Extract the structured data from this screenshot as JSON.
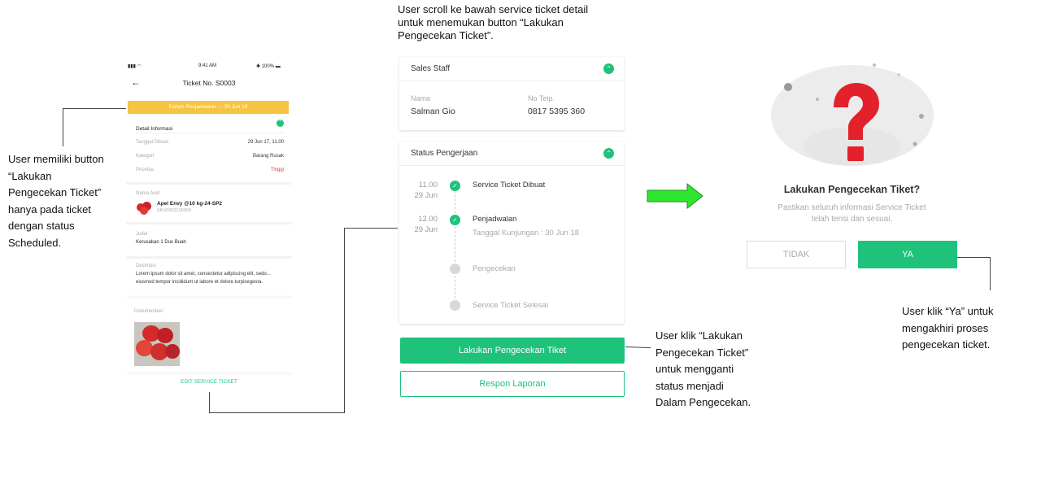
{
  "notes": {
    "top": "User scroll ke bawah  service ticket detail untuk menemukan  button “Lakukan Pengecekan Ticket”.",
    "left": "User memiliki button “Lakukan Pengecekan Ticket” hanya pada ticket dengan status Scheduled.",
    "middle": "User klik “Lakukan Pengecekan Ticket” untuk mengganti status menjadi Dalam Pengecekan.",
    "right": "User klik “Ya” untuk mengakhiri proses pengecekan ticket."
  },
  "phone1": {
    "status_time": "9:41 AM",
    "status_battery": "100%",
    "title": "Ticket No. S0003",
    "banner": "Dalam Penjadwalan — 30 Jun 18",
    "detail_header": "Detail Informasi",
    "rows": [
      {
        "label": "Tanggal Dibuat",
        "value": "29 Jun 17, 11.00"
      },
      {
        "label": "Kategori",
        "value": "Barang Rusak"
      },
      {
        "label": "Prioritas",
        "value": "Tinggi"
      }
    ],
    "asset_label": "Nama Aset",
    "asset_name": "Apel Envy @10 kg-24-SP2",
    "asset_sku": "SKU0002120004",
    "judul_label": "Judul",
    "judul_value": "Kerusakan 1 Dus Buah",
    "desc_label": "Deskripsi",
    "desc_value": "Lorem ipsum dolor sit amet, consectetur adipiscing elit, sedo... eiusmod tempor incididunt ut labore et dolore turpisegesta.",
    "doc_label": "Dokumentasi",
    "edit_button": "EDIT SERVICE TICKET"
  },
  "middle": {
    "sales_header": "Sales Staff",
    "nama_label": "Nama",
    "nama_value": "Salman Gio",
    "telp_label": "No Telp.",
    "telp_value": "0817 5395 360",
    "status_header": "Status Pengerjaan",
    "timeline": [
      {
        "time": "11.00",
        "date": "29 Jun",
        "label": "Service Ticket Dibuat",
        "done": true
      },
      {
        "time": "12.00",
        "date": "29 Jun",
        "label": "Penjadwalan",
        "sub": "Tanggal Kunjungan : 30 Jun 18",
        "done": true
      },
      {
        "label": "Pengecekan",
        "done": false
      },
      {
        "label": "Service Ticket Selesai",
        "done": false
      }
    ],
    "primary_button": "Lakukan Pengecekan Tiket",
    "secondary_button": "Respon Laporan"
  },
  "dialog": {
    "icon": "question-mark-icon",
    "title": "Lakukan Pengecekan Tiket?",
    "message_line1": "Pastikan seluruh informasi Service Ticket",
    "message_line2": "telah terisi dan sesuai.",
    "cancel_label": "TIDAK",
    "confirm_label": "YA"
  },
  "colors": {
    "green": "#1ec27a",
    "yellow": "#f7c343",
    "red": "#e23a3a",
    "arrow": "#2fe62f"
  }
}
